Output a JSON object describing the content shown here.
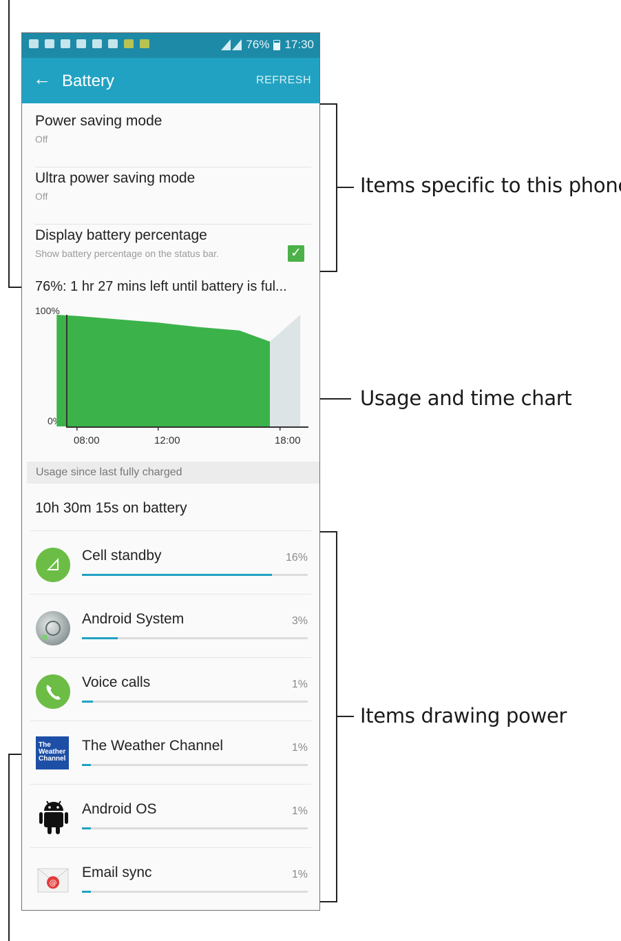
{
  "callouts": {
    "items_specific": "Items specific to this phone",
    "usage_chart": "Usage and time chart",
    "items_drawing": "Items drawing power"
  },
  "status_bar": {
    "battery": "76%",
    "time": "17:30"
  },
  "app_bar": {
    "title": "Battery",
    "action": "REFRESH"
  },
  "settings": [
    {
      "title": "Power saving mode",
      "subtitle": "Off"
    },
    {
      "title": "Ultra power saving mode",
      "subtitle": "Off"
    },
    {
      "title": "Display battery percentage",
      "subtitle": "Show battery percentage on the status bar.",
      "checked": true
    }
  ],
  "estimate": "76%: 1 hr 27 mins left until battery is ful...",
  "chart_data": {
    "type": "area",
    "title": "",
    "ylim": [
      0,
      100
    ],
    "y_ticks": [
      "100%",
      "0%"
    ],
    "x_ticks": [
      "08:00",
      "12:00",
      "18:00"
    ],
    "series": [
      {
        "x": [
          "07:00",
          "08:00",
          "10:00",
          "12:00",
          "14:00",
          "16:00",
          "17:30"
        ],
        "values": [
          100,
          99,
          96,
          93,
          89,
          86,
          76
        ]
      },
      {
        "x": [
          "17:30",
          "19:00"
        ],
        "values": [
          76,
          100
        ]
      }
    ],
    "colors": {
      "usage": "#3bb34a",
      "prediction": "#dde4e6"
    }
  },
  "usage_header": "Usage since last fully charged",
  "on_battery": "10h 30m 15s on battery",
  "usage_items": [
    {
      "name": "Cell standby",
      "pct": "16%",
      "value": 0.16
    },
    {
      "name": "Android System",
      "pct": "3%",
      "value": 0.03
    },
    {
      "name": "Voice calls",
      "pct": "1%",
      "value": 0.01
    },
    {
      "name": "The Weather Channel",
      "pct": "1%",
      "value": 0.01,
      "logo_text": "The Weather Channel"
    },
    {
      "name": "Android OS",
      "pct": "1%",
      "value": 0.01
    },
    {
      "name": "Email sync",
      "pct": "1%",
      "value": 0.01
    }
  ],
  "colors": {
    "accent": "#22a2c2",
    "status_bar": "#1d8aa7",
    "check": "#4cb148"
  }
}
